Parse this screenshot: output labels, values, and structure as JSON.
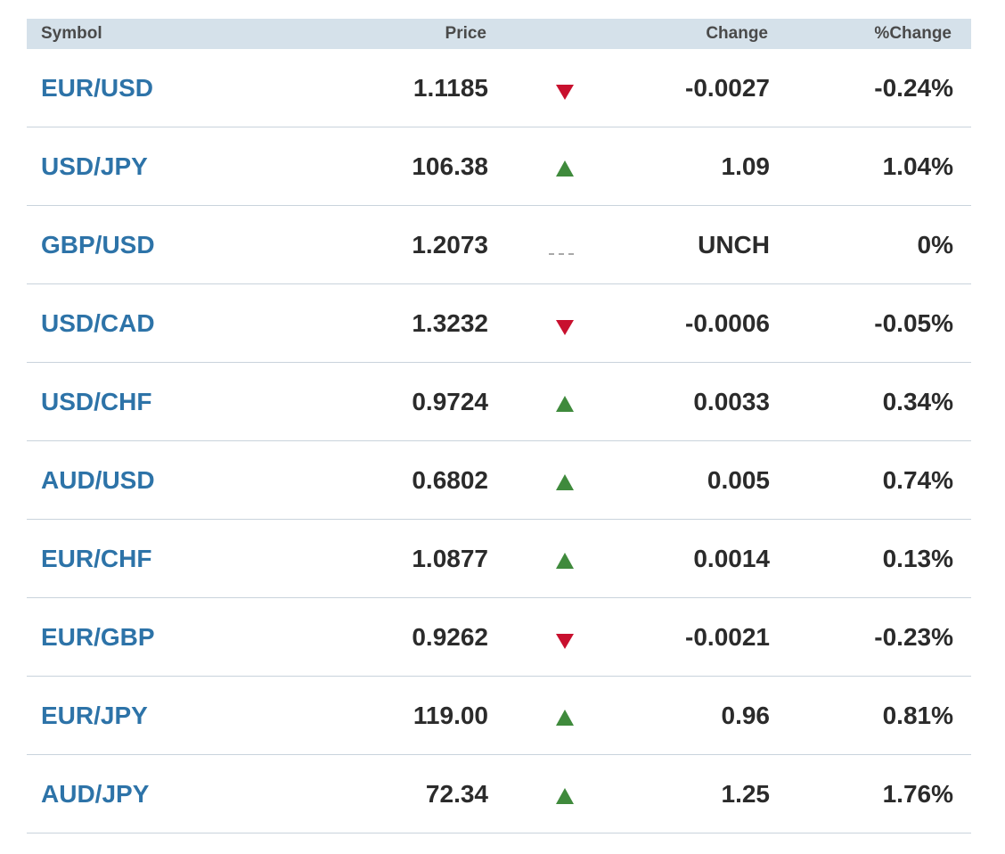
{
  "table": {
    "headers": {
      "symbol": "Symbol",
      "price": "Price",
      "change": "Change",
      "pct_change": "%Change"
    },
    "rows": [
      {
        "symbol": "EUR/USD",
        "price": "1.1185",
        "direction": "down",
        "change": "-0.0027",
        "pct_change": "-0.24%"
      },
      {
        "symbol": "USD/JPY",
        "price": "106.38",
        "direction": "up",
        "change": "1.09",
        "pct_change": "1.04%"
      },
      {
        "symbol": "GBP/USD",
        "price": "1.2073",
        "direction": "flat",
        "change": "UNCH",
        "pct_change": "0%"
      },
      {
        "symbol": "USD/CAD",
        "price": "1.3232",
        "direction": "down",
        "change": "-0.0006",
        "pct_change": "-0.05%"
      },
      {
        "symbol": "USD/CHF",
        "price": "0.9724",
        "direction": "up",
        "change": "0.0033",
        "pct_change": "0.34%"
      },
      {
        "symbol": "AUD/USD",
        "price": "0.6802",
        "direction": "up",
        "change": "0.005",
        "pct_change": "0.74%"
      },
      {
        "symbol": "EUR/CHF",
        "price": "1.0877",
        "direction": "up",
        "change": "0.0014",
        "pct_change": "0.13%"
      },
      {
        "symbol": "EUR/GBP",
        "price": "0.9262",
        "direction": "down",
        "change": "-0.0021",
        "pct_change": "-0.23%"
      },
      {
        "symbol": "EUR/JPY",
        "price": "119.00",
        "direction": "up",
        "change": "0.96",
        "pct_change": "0.81%"
      },
      {
        "symbol": "AUD/JPY",
        "price": "72.34",
        "direction": "up",
        "change": "1.25",
        "pct_change": "1.76%"
      }
    ]
  },
  "colors": {
    "header_bg": "#d5e1ea",
    "symbol_link": "#2d73a8",
    "up": "#3f8a3c",
    "down": "#c8102e",
    "flat": "#a8a8a8",
    "row_divider": "#c9d3dc"
  },
  "icons": {
    "up": "triangle-up-icon",
    "down": "triangle-down-icon",
    "flat": "dashed-line-icon"
  }
}
